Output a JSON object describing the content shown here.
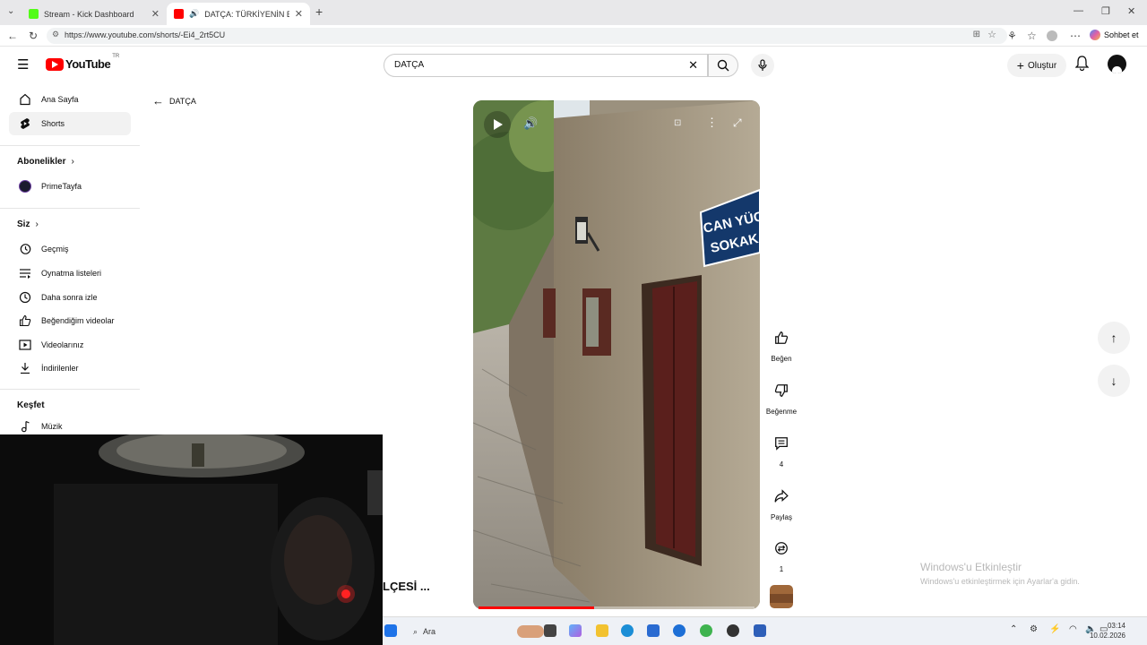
{
  "browser": {
    "tabs": [
      {
        "title": "Stream - Kick Dashboard",
        "active": false,
        "favicon_color": "#53fc18"
      },
      {
        "title": "DATÇA: TÜRKİYENİN EN GÜZE",
        "active": true,
        "favicon_color": "#ff0000"
      }
    ],
    "url": "https://www.youtube.com/shorts/-Ei4_2rt5CU",
    "profile_button": "Sohbet et"
  },
  "youtube": {
    "logo": "YouTube",
    "region": "TR",
    "search_value": "DATÇA",
    "create_label": "Oluştur"
  },
  "sidebar": {
    "items": [
      {
        "label": "Ana Sayfa",
        "icon": "home-icon"
      },
      {
        "label": "Shorts",
        "icon": "shorts-icon",
        "active": true
      }
    ],
    "subscriptions_title": "Abonelikler",
    "subscriptions": [
      {
        "label": "PrimeTayfa"
      }
    ],
    "you_title": "Siz",
    "you_items": [
      {
        "label": "Geçmiş",
        "icon": "history-icon"
      },
      {
        "label": "Oynatma listeleri",
        "icon": "playlist-icon"
      },
      {
        "label": "Daha sonra izle",
        "icon": "watch-later-icon"
      },
      {
        "label": "Beğendiğim videolar",
        "icon": "like-icon"
      },
      {
        "label": "Videolarınız",
        "icon": "your-videos-icon"
      },
      {
        "label": "İndirilenler",
        "icon": "download-icon"
      }
    ],
    "explore_title": "Keşfet",
    "explore_items": [
      {
        "label": "Müzik",
        "icon": "music-icon"
      }
    ]
  },
  "main": {
    "back_label": "DATÇA",
    "video_sign_line1": "CAN YÜCEL",
    "video_sign_line2": "SOKAK",
    "progress": 0.42,
    "title_fragment": "LÇESİ  ..."
  },
  "actions": {
    "like_label": "Beğen",
    "dislike_label": "Beğenme",
    "comments_count": "4",
    "share_label": "Paylaş",
    "remix_count": "1"
  },
  "watermark": {
    "line1": "Windows'u Etkinleştir",
    "line2": "Windows'u etkinleştirmek için Ayarlar'a gidin."
  },
  "taskbar": {
    "search_label": "Ara",
    "time": "03:14",
    "date": "10.02.2026"
  }
}
